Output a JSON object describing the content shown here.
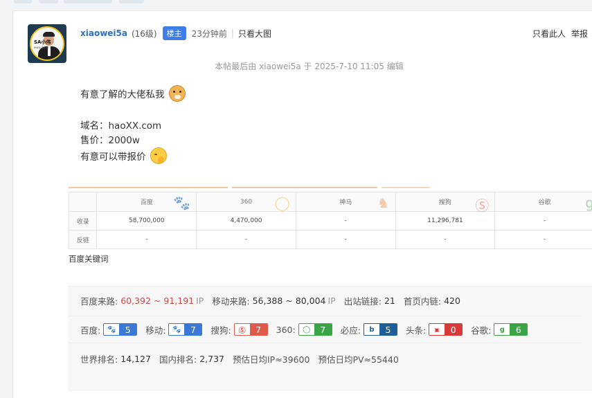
{
  "post": {
    "author": "xiaowei5a",
    "level": "(16级)",
    "role_badge": "楼主",
    "time": "23分钟前",
    "divider": "|",
    "view_big_image": "只看大图",
    "only_this_user": "只看此人",
    "report": "举报",
    "avatar_text": "SA小伟",
    "avatar_subtext": "www.5a.co",
    "edit_note": "本帖最后由 xiaowei5a 于 2025-7-10 11:05 编辑",
    "body": {
      "line1": "有意了解的大佬私我",
      "line1_emoji": "doge-emoji",
      "domain_line": "域名：haoXX.com",
      "price_line": "售价：2000w",
      "line4": "有意可以带报价",
      "line4_emoji": "pray-emoji"
    }
  },
  "seo_table": {
    "engines": [
      "百度",
      "360",
      "神马",
      "搜狗",
      "谷歌"
    ],
    "engine_icons": [
      "paw-icon",
      "circle-q-icon",
      "shenma-icon",
      "sogou-s-icon",
      "google-g-icon"
    ],
    "engine_colors": [
      "#3a6ed8",
      "#f2c24a",
      "#e8a46b",
      "#e86a5a",
      "#6dbb6a"
    ],
    "rows": [
      {
        "label": "收录",
        "values": [
          "58,700,000",
          "4,470,000",
          "-",
          "11,296,781",
          "-"
        ]
      },
      {
        "label": "反链",
        "values": [
          "-",
          "-",
          "-",
          "-",
          "-"
        ]
      }
    ],
    "keywords_label": "百度关键词"
  },
  "stats": {
    "baidu_traffic_label": "百度来路:",
    "baidu_traffic_range": "60,392 ~ 91,191",
    "ip_unit": "IP",
    "mobile_traffic_label": "移动来路:",
    "mobile_traffic_range": "56,388 ~ 80,004",
    "outbound_label": "出站链接:",
    "outbound_value": "21",
    "homepage_links_label": "首页内链:",
    "homepage_links_value": "420",
    "weights": [
      {
        "label": "百度:",
        "value": "5",
        "icon": "baidu-paw-icon",
        "color": "#3a78d8"
      },
      {
        "label": "移动:",
        "value": "7",
        "icon": "mobile-paw-icon",
        "color": "#3a78d8"
      },
      {
        "label": "搜狗:",
        "value": "7",
        "icon": "sogou-icon",
        "color": "#e05a4a"
      },
      {
        "label": "360:",
        "value": "7",
        "icon": "360-icon",
        "color": "#3aa544"
      },
      {
        "label": "必应:",
        "value": "5",
        "icon": "bing-icon",
        "color": "#1d5f98"
      },
      {
        "label": "头条:",
        "value": "0",
        "icon": "toutiao-icon",
        "color": "#d83a3a"
      },
      {
        "label": "谷歌:",
        "value": "6",
        "icon": "google-icon",
        "color": "#3aa544"
      }
    ],
    "world_rank_label": "世界排名:",
    "world_rank_value": "14,127",
    "domestic_rank_label": "国内排名:",
    "domestic_rank_value": "2,737",
    "daily_ip_label": "预估日均IP≈39600",
    "daily_pv_label": "预估日均PV≈55440"
  }
}
